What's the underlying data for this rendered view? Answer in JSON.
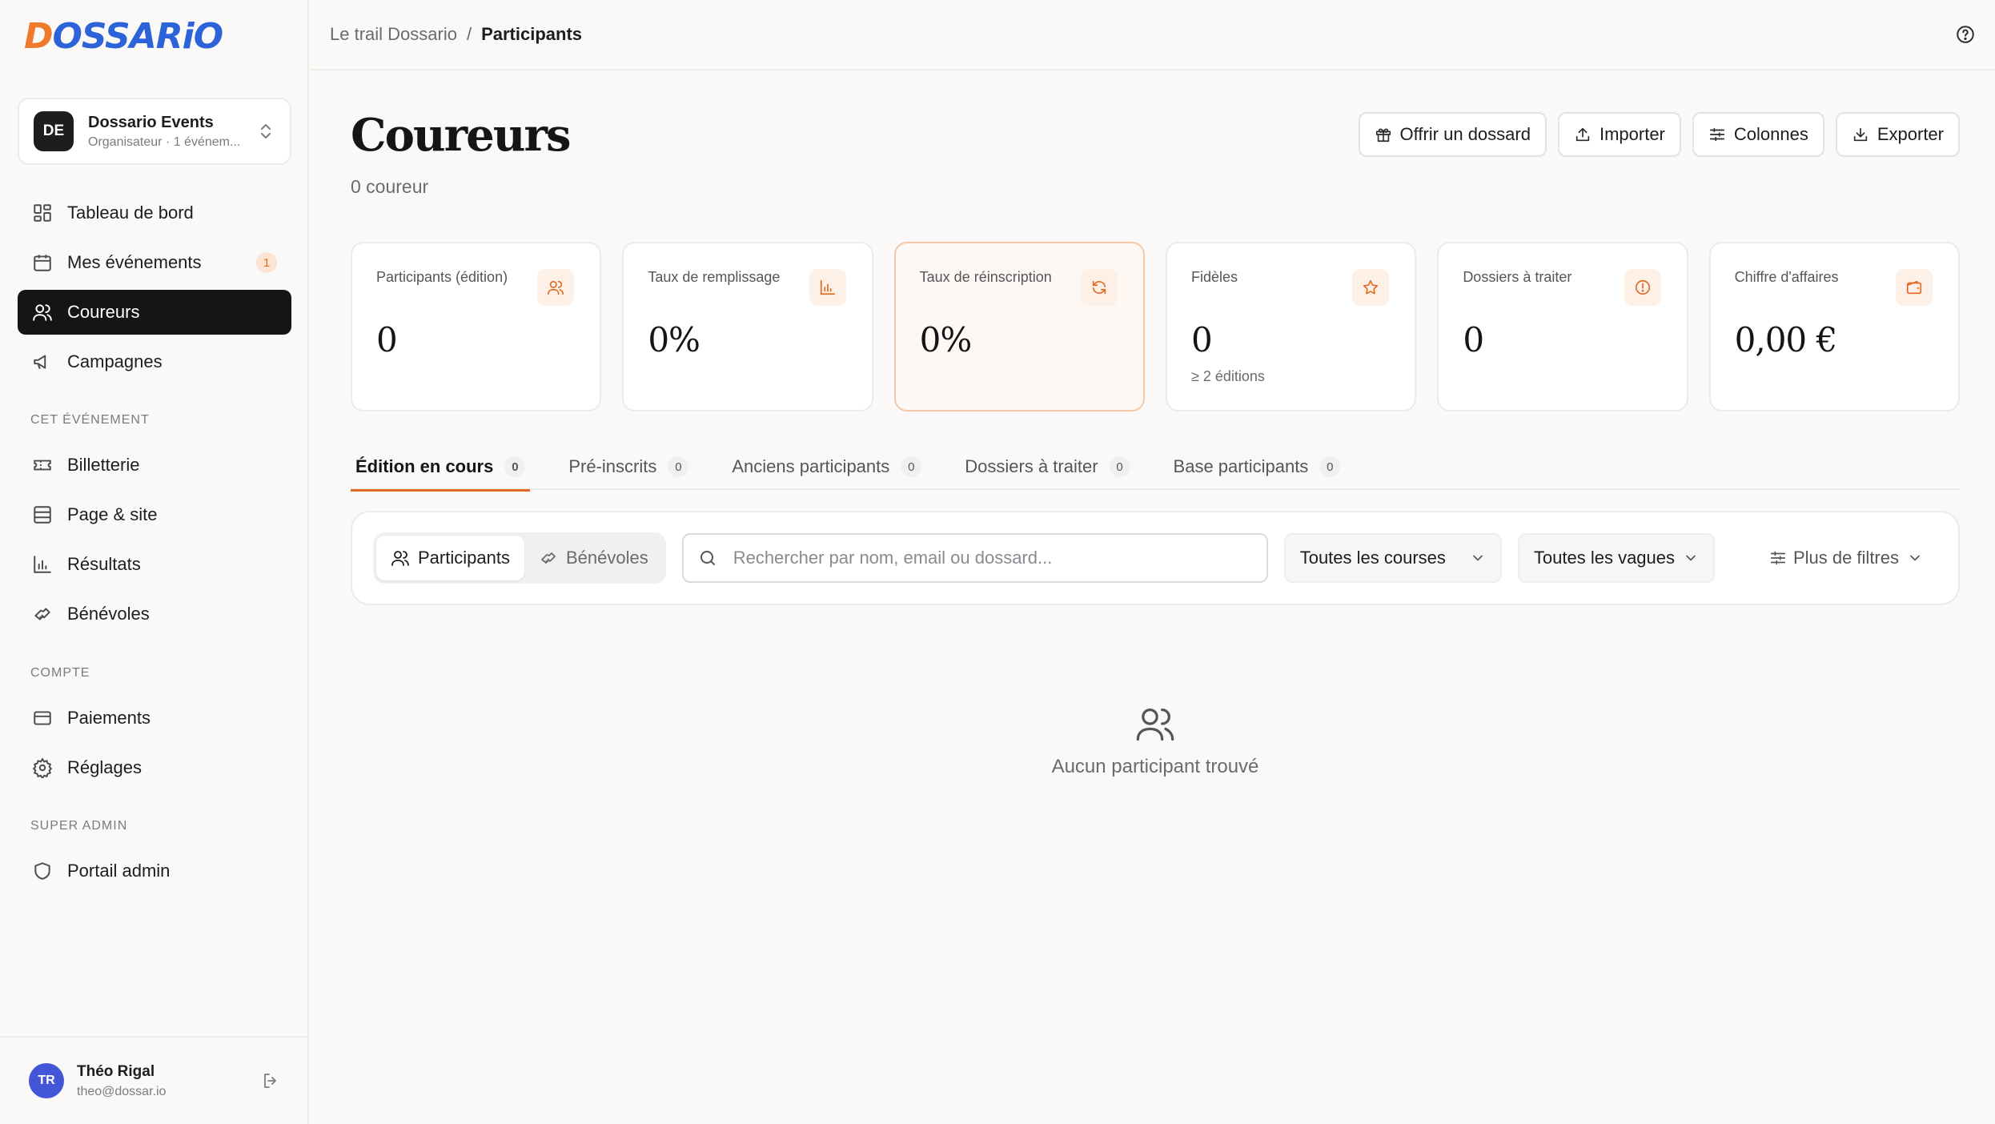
{
  "brand": {
    "logo_d": "D",
    "logo_rest": "OSSARiO",
    "logo_color": "#2c63d8",
    "logo_accent": "#f07a2c"
  },
  "org": {
    "initials": "DE",
    "name": "Dossario Events",
    "subtitle": "Organisateur · 1 événem..."
  },
  "nav": {
    "main": [
      {
        "label": "Tableau de bord",
        "icon": "dashboard-icon"
      },
      {
        "label": "Mes événements",
        "icon": "calendar-icon",
        "badge": "1"
      },
      {
        "label": "Coureurs",
        "icon": "users-icon",
        "active": true
      },
      {
        "label": "Campagnes",
        "icon": "megaphone-icon"
      }
    ],
    "section_event": "CET ÉVÉNEMENT",
    "event": [
      {
        "label": "Billetterie",
        "icon": "ticket-icon"
      },
      {
        "label": "Page & site",
        "icon": "layout-icon"
      },
      {
        "label": "Résultats",
        "icon": "bar-chart-icon"
      },
      {
        "label": "Bénévoles",
        "icon": "handshake-icon"
      }
    ],
    "section_account": "COMPTE",
    "account": [
      {
        "label": "Paiements",
        "icon": "credit-card-icon"
      },
      {
        "label": "Réglages",
        "icon": "gear-icon"
      }
    ],
    "section_admin": "SUPER ADMIN",
    "admin": [
      {
        "label": "Portail admin",
        "icon": "shield-icon"
      }
    ]
  },
  "user": {
    "initials": "TR",
    "name": "Théo Rigal",
    "email": "theo@dossar.io"
  },
  "breadcrumb": {
    "parent": "Le trail Dossario",
    "separator": "/",
    "current": "Participants"
  },
  "page": {
    "title": "Coureurs",
    "subtitle": "0 coureur"
  },
  "actions": {
    "offer": "Offrir un dossard",
    "import": "Importer",
    "columns": "Colonnes",
    "export": "Exporter"
  },
  "stats": [
    {
      "label": "Participants (édition)",
      "value": "0",
      "icon": "users-icon"
    },
    {
      "label": "Taux de remplissage",
      "value": "0%",
      "icon": "bar-chart-icon"
    },
    {
      "label": "Taux de réinscription",
      "value": "0%",
      "icon": "refresh-icon",
      "highlight": true
    },
    {
      "label": "Fidèles",
      "value": "0",
      "note": "≥ 2 éditions",
      "icon": "star-icon"
    },
    {
      "label": "Dossiers à traiter",
      "value": "0",
      "icon": "alert-circle-icon"
    },
    {
      "label": "Chiffre d'affaires",
      "value": "0,00 €",
      "icon": "wallet-icon"
    }
  ],
  "tabs": [
    {
      "label": "Édition en cours",
      "count": "0",
      "active": true
    },
    {
      "label": "Pré-inscrits",
      "count": "0"
    },
    {
      "label": "Anciens participants",
      "count": "0"
    },
    {
      "label": "Dossiers à traiter",
      "count": "0"
    },
    {
      "label": "Base participants",
      "count": "0"
    }
  ],
  "filters": {
    "segment": {
      "participants": "Participants",
      "volunteers": "Bénévoles"
    },
    "search_placeholder": "Rechercher par nom, email ou dossard...",
    "courses": "Toutes les courses",
    "waves": "Toutes les vagues",
    "more": "Plus de filtres"
  },
  "empty": {
    "text": "Aucun participant trouvé"
  },
  "colors": {
    "accent": "#e06b25",
    "dark": "#151517"
  }
}
